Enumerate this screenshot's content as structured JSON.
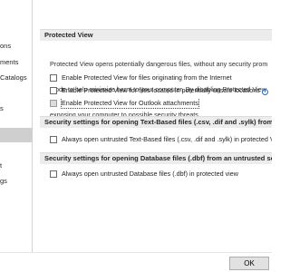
{
  "sidebar": {
    "items": [
      {
        "label": "ons",
        "selected": false
      },
      {
        "label": "ments",
        "selected": false
      },
      {
        "label": "Catalogs",
        "selected": false
      },
      {
        "label": "s",
        "selected": false
      },
      {
        "label": "",
        "selected": true
      },
      {
        "label": "t",
        "selected": false
      },
      {
        "label": "gs",
        "selected": false
      }
    ]
  },
  "protected_view": {
    "title": "Protected View",
    "description_lines": [
      "Protected View opens potentially dangerous files, without any security prom",
      "mode to help minimize harm to your computer. By disabling Protected View",
      "exposing your computer to possible security threats."
    ],
    "options": [
      {
        "label": "Enable Protected View for files originating from the Internet",
        "checked": false,
        "info": false
      },
      {
        "label": "Enable Protected View for files located in potentially unsafe locations",
        "checked": false,
        "info": true
      },
      {
        "label": "Enable Protected View for Outlook attachments",
        "checked": false,
        "info": false,
        "disabled": true,
        "focused": true
      }
    ]
  },
  "text_files": {
    "title": "Security settings for opening Text-Based files (.csv, .dif and .sylk) from an",
    "option": {
      "label": "Always open untrusted Text-Based files (.csv, .dif and .sylk) in protected V",
      "checked": false
    }
  },
  "database_files": {
    "title": "Security settings for opening Database files (.dbf) from an untrusted sour",
    "option": {
      "label": "Always open untrusted Database files (.dbf) in protected view",
      "checked": false
    }
  },
  "footer": {
    "ok_label": "OK"
  }
}
